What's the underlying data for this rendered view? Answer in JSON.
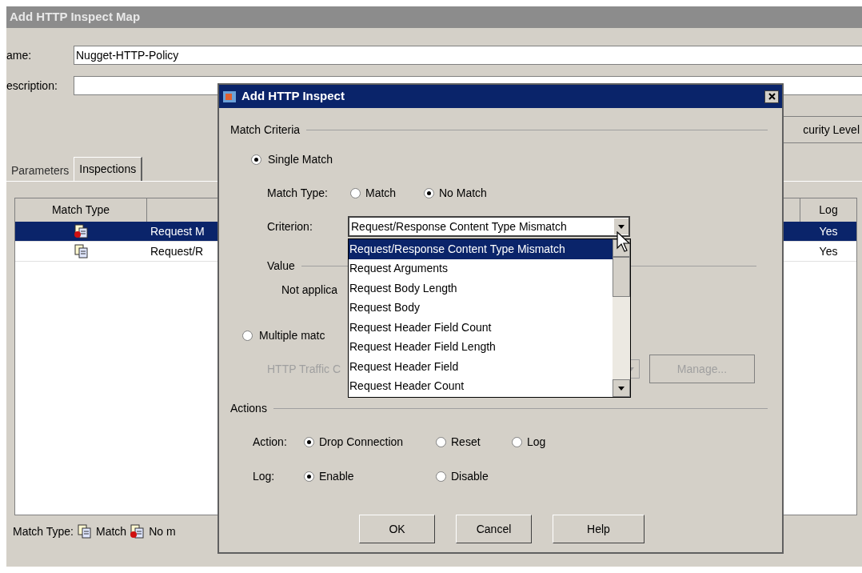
{
  "main_window": {
    "title": "Add HTTP Inspect Map",
    "name_label": "ame:",
    "name_value": "Nugget-HTTP-Policy",
    "description_label": "escription:",
    "security_level_button": "curity Level",
    "tabs": [
      {
        "label": "Parameters",
        "selected": false
      },
      {
        "label": "Inspections",
        "selected": true
      }
    ],
    "table": {
      "columns": [
        "Match Type",
        "Log"
      ],
      "rows": [
        {
          "kind": "no_match",
          "criterion": "Request M",
          "log": "Yes",
          "selected": true
        },
        {
          "kind": "match",
          "criterion": "Request/R",
          "log": "Yes",
          "selected": false
        }
      ]
    },
    "legend": {
      "label": "Match Type:",
      "items": [
        {
          "kind": "match",
          "label": "Match"
        },
        {
          "kind": "no_match",
          "label": "No m"
        }
      ]
    }
  },
  "dialog": {
    "title": "Add HTTP Inspect",
    "match_criteria_label": "Match Criteria",
    "single_match": {
      "label": "Single Match",
      "selected": true
    },
    "match_type": {
      "label": "Match Type:",
      "options": [
        {
          "label": "Match",
          "selected": false
        },
        {
          "label": "No Match",
          "selected": true
        }
      ]
    },
    "criterion": {
      "label": "Criterion:",
      "value": "Request/Response Content Type Mismatch",
      "expanded": true,
      "options": [
        {
          "label": "Request/Response Content Type Mismatch",
          "selected": true
        },
        {
          "label": "Request Arguments",
          "selected": false
        },
        {
          "label": "Request Body Length",
          "selected": false
        },
        {
          "label": "Request Body",
          "selected": false
        },
        {
          "label": "Request Header Field Count",
          "selected": false
        },
        {
          "label": "Request Header Field Length",
          "selected": false
        },
        {
          "label": "Request Header Field",
          "selected": false
        },
        {
          "label": "Request Header Count",
          "selected": false
        }
      ]
    },
    "value_label": "Value",
    "value_text": "Not applica",
    "multiple_matches": {
      "label": "Multiple matc",
      "selected": false
    },
    "http_traffic": {
      "label": "HTTP Traffic C",
      "disabled": true
    },
    "manage_button": {
      "label": "Manage...",
      "disabled": true
    },
    "actions_label": "Actions",
    "action": {
      "label": "Action:",
      "options": [
        {
          "label": "Drop Connection",
          "selected": true
        },
        {
          "label": "Reset",
          "selected": false
        },
        {
          "label": "Log",
          "selected": false
        }
      ]
    },
    "log": {
      "label": "Log:",
      "options": [
        {
          "label": "Enable",
          "selected": true
        },
        {
          "label": "Disable",
          "selected": false
        }
      ]
    },
    "buttons": [
      "OK",
      "Cancel",
      "Help"
    ]
  }
}
